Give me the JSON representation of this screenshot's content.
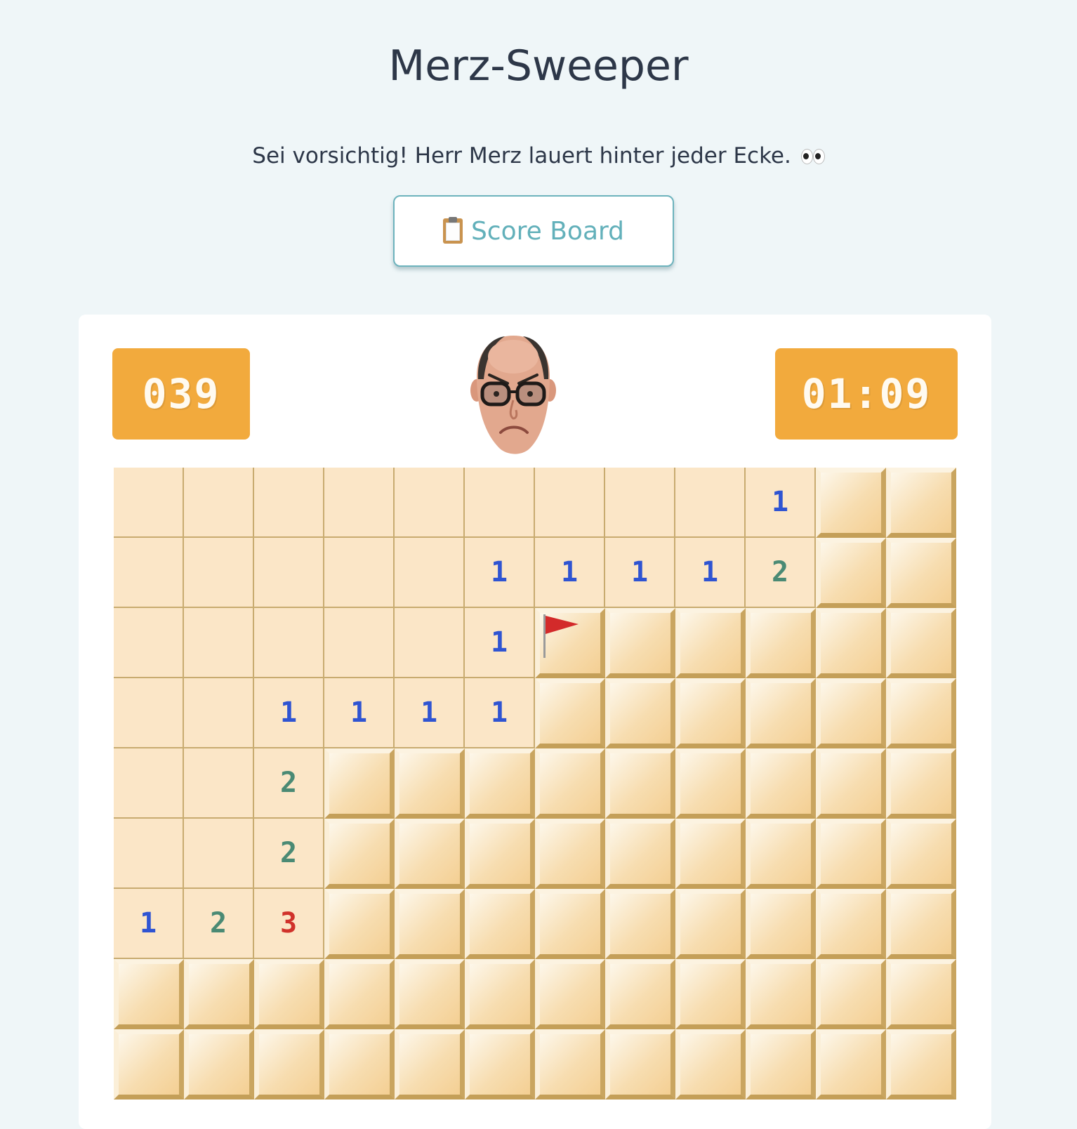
{
  "page": {
    "title": "Merz-Sweeper",
    "subtitle": "Sei vorsichtig! Herr Merz lauert hinter jeder Ecke.",
    "subtitle_icon": "eyes-emoji",
    "score_button_icon": "clipboard-emoji",
    "score_button_label": "Score Board"
  },
  "game": {
    "mine_counter": "039",
    "timer": "01:09",
    "face_icon": "merz-face",
    "colors": {
      "accent": "#f2aa3d",
      "number_1": "#2f54d2",
      "number_2": "#4a8a74",
      "number_3": "#d0322b",
      "open_cell": "#fbe6c7"
    },
    "columns": 12,
    "board": [
      [
        "",
        "",
        "",
        "",
        "",
        "",
        "",
        "",
        "",
        "1",
        "#",
        "#"
      ],
      [
        "",
        "",
        "",
        "",
        "",
        "1",
        "1",
        "1",
        "1",
        "2",
        "#",
        "#"
      ],
      [
        "",
        "",
        "",
        "",
        "",
        "1",
        "F",
        "#",
        "#",
        "#",
        "#",
        "#"
      ],
      [
        "",
        "",
        "1",
        "1",
        "1",
        "1",
        "#",
        "#",
        "#",
        "#",
        "#",
        "#"
      ],
      [
        "",
        "",
        "2",
        "#",
        "#",
        "#",
        "#",
        "#",
        "#",
        "#",
        "#",
        "#"
      ],
      [
        "",
        "",
        "2",
        "#",
        "#",
        "#",
        "#",
        "#",
        "#",
        "#",
        "#",
        "#"
      ],
      [
        "1",
        "2",
        "3",
        "#",
        "#",
        "#",
        "#",
        "#",
        "#",
        "#",
        "#",
        "#"
      ],
      [
        "#",
        "#",
        "#",
        "#",
        "#",
        "#",
        "#",
        "#",
        "#",
        "#",
        "#",
        "#"
      ],
      [
        "#",
        "#",
        "#",
        "#",
        "#",
        "#",
        "#",
        "#",
        "#",
        "#",
        "#",
        "#"
      ]
    ]
  }
}
